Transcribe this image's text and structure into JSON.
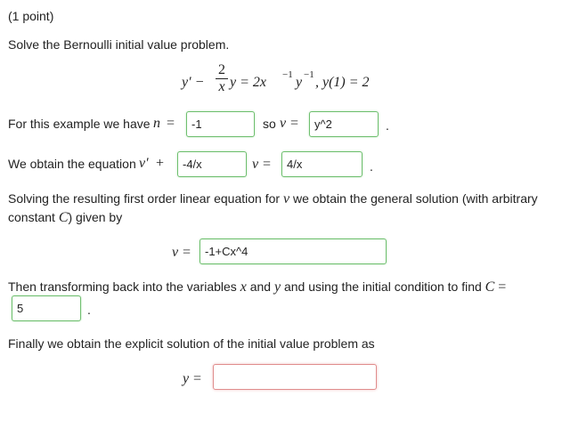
{
  "problem": {
    "points": "(1 point)",
    "instruction": "Solve the Bernoulli initial value problem.",
    "equation": {
      "lhs_yprime": "y′ −",
      "frac_num": "2",
      "frac_den": "x",
      "middle": "y = 2x",
      "exp1": "−1",
      "y2": "y",
      "exp2": "−1",
      "init": ", y(1) = 2"
    }
  },
  "step_n": {
    "text": "For this example we have",
    "n_var": "n",
    "eq": "=",
    "n_value": "-1",
    "so": "so",
    "v_var": "v",
    "eq2": "=",
    "v_value": "y^2",
    "period": "."
  },
  "step_eq": {
    "text": "We obtain the equation",
    "vprime": "v′",
    "plus": "+",
    "coef_value": "-4/x",
    "v_var": "v",
    "eq": "=",
    "rhs_value": "4/x",
    "period": "."
  },
  "step_general": {
    "text1": "Solving the resulting first order linear equation for",
    "v_var": "v",
    "text2": "we obtain the general solution (with arbitrary",
    "text3": "constant",
    "C_var": "C",
    "text4": ") given by",
    "lhs": "v",
    "eq": "=",
    "value": "-1+Cx^4"
  },
  "step_C": {
    "text1": "Then transforming back into the variables",
    "x_var": "x",
    "and": "and",
    "y_var": "y",
    "text2": "and using the initial condition to find",
    "C_var": "C",
    "eq": "=",
    "value": "5",
    "period": "."
  },
  "step_final": {
    "text": "Finally we obtain the explicit solution of the initial value problem as",
    "lhs": "y",
    "eq": "=",
    "value": ""
  },
  "colors": {
    "correct_border": "#6fbf6f",
    "incorrect_border": "#e08d8d"
  }
}
